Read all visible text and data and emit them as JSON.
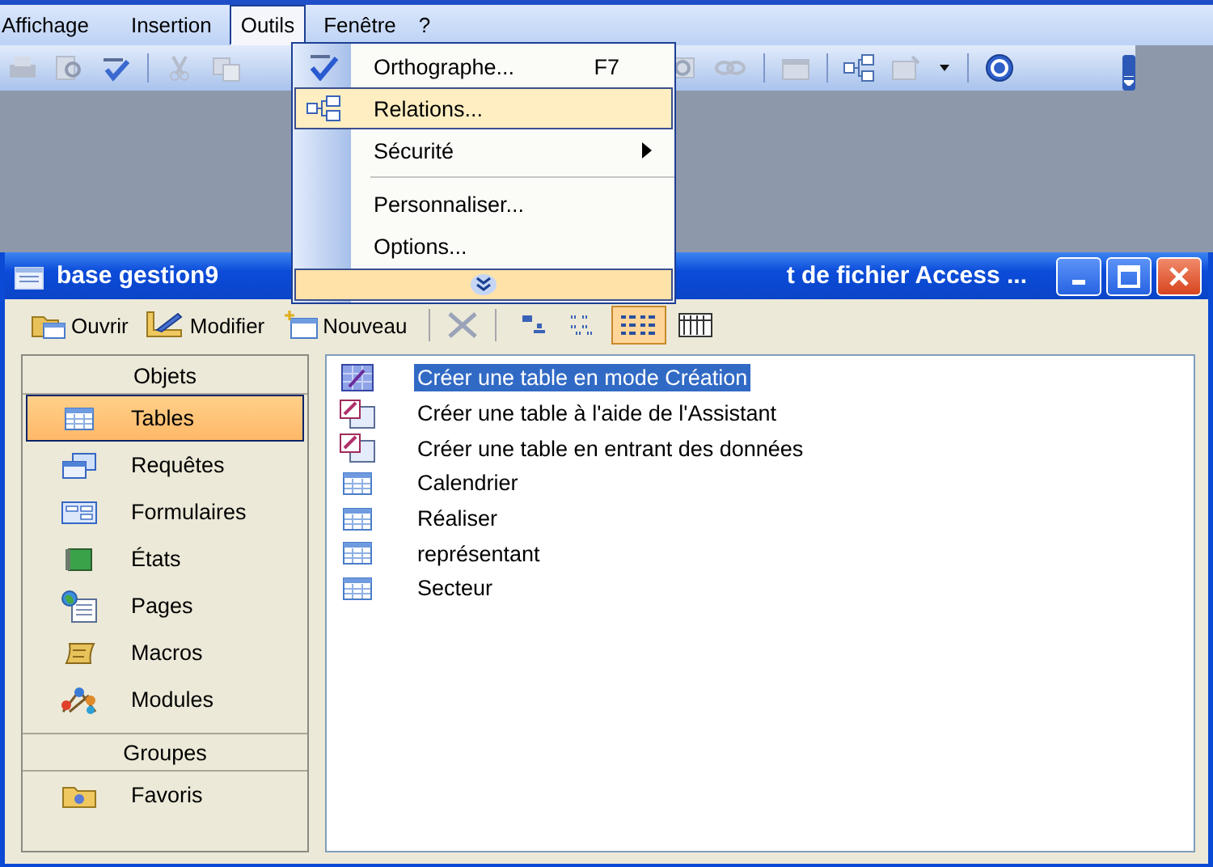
{
  "menu_bar": {
    "items": [
      {
        "label": "Affichage",
        "selected": false
      },
      {
        "label": "Insertion",
        "selected": false
      },
      {
        "label": "Outils",
        "selected": true
      },
      {
        "label": "Fenêtre",
        "selected": false
      },
      {
        "label": "?",
        "selected": false
      }
    ]
  },
  "open_menu": {
    "items": [
      {
        "kind": "item",
        "label": "Orthographe...",
        "shortcut": "F7",
        "selected": false
      },
      {
        "kind": "item",
        "label": "Relations...",
        "selected": true
      },
      {
        "kind": "submenu",
        "label": "Sécurité",
        "selected": false
      },
      {
        "kind": "separator"
      },
      {
        "kind": "item",
        "label": "Personnaliser...",
        "selected": false
      },
      {
        "kind": "item",
        "label": "Options...",
        "selected": false
      },
      {
        "kind": "expand",
        "selected": true
      }
    ]
  },
  "window": {
    "title_left": "base gestion9",
    "title_right": "t de fichier Access ...",
    "toolbar": {
      "buttons": [
        {
          "label": "Ouvrir"
        },
        {
          "label": "Modifier"
        },
        {
          "label": "Nouveau"
        }
      ],
      "views": [
        {
          "selected": false
        },
        {
          "selected": false
        },
        {
          "selected": true
        },
        {
          "selected": false
        }
      ]
    },
    "objects": {
      "header": "Objets",
      "items": [
        {
          "label": "Tables",
          "selected": true
        },
        {
          "label": "Requêtes",
          "selected": false
        },
        {
          "label": "Formulaires",
          "selected": false
        },
        {
          "label": "États",
          "selected": false
        },
        {
          "label": "Pages",
          "selected": false
        },
        {
          "label": "Macros",
          "selected": false
        },
        {
          "label": "Modules",
          "selected": false
        }
      ],
      "groups_header": "Groupes",
      "groups": [
        {
          "label": "Favoris"
        }
      ]
    },
    "list": {
      "items": [
        {
          "kind": "design",
          "label": "Créer une table en mode Création",
          "selected": true
        },
        {
          "kind": "wizard",
          "label": "Créer une table à l'aide de l'Assistant",
          "selected": false
        },
        {
          "kind": "wizard",
          "label": "Créer une table en entrant des données",
          "selected": false
        },
        {
          "kind": "table",
          "label": "Calendrier",
          "selected": false
        },
        {
          "kind": "table",
          "label": "Réaliser",
          "selected": false
        },
        {
          "kind": "table",
          "label": "représentant",
          "selected": false
        },
        {
          "kind": "table",
          "label": "Secteur",
          "selected": false
        }
      ]
    }
  }
}
